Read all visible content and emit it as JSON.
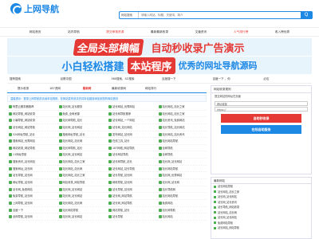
{
  "header": {
    "logo_text": "上网导航",
    "search_select": "网站搜索",
    "search_placeholder": "请输入网站、标题、关键词、简介",
    "search_button": "Q"
  },
  "nav": [
    "网站首页",
    "站内导航",
    "提交审核资源",
    "最新最新收录",
    "文章资讯",
    "人气排行榜",
    "收入榜优秀"
  ],
  "banner1": {
    "pill": "全局头部横幅",
    "text": "自动秒收录广告演示"
  },
  "banner2": {
    "t1": "小白轻松搭建",
    "pill": "本站程序",
    "t2": "优秀的网址导航源码"
  },
  "links": [
    "搜狗搜索",
    "谷歌中国",
    "360搜索、SO搜索",
    "百度搜一下",
    "百度一下 ，你",
    "必应"
  ],
  "tabs": [
    "提示收录",
    "187资网",
    "最新网",
    "最新收录网",
    "网站排行"
  ],
  "notice": "温馨提示：登录上网导航前请读本站规则，在网站发布前请先将本站链接添加到您的网站首页",
  "grid": [
    "阿里云服务器推荐",
    "站长网_站长服务",
    "站长网站_优秀网站",
    "站长网站_站长之家",
    "网站导航_网站收录",
    "免费_全网资源",
    "站长网导航推荐",
    "站长网站_站长之家",
    "小编导航_网站收录",
    "站长网导航_站长",
    "站长网站_一个网站",
    "站长资讯_免费网站",
    "站长网站_网站导航",
    "站长网_站长网站",
    "站长网_站长网站",
    "站长导航_站长网站",
    "520网址导航_站长",
    "搜索网址导航_站长",
    "发布网站_站长网",
    "站长网站_站长资讯",
    "搜索网站_优秀网站",
    "站长网站_站长网",
    "在线工具_站长",
    "站长网站导航",
    "网站收录_网站导航",
    "站长网导航_站长",
    "187网络_网站导航",
    "全网导航",
    "11网址导航",
    "站长网_站长网站",
    "站长网站导航",
    "全网导航",
    "搜索资讯_站长网站",
    "站长网站_站长之家",
    "站长网导航_站长",
    "站长网_站长网站",
    "搜索网址_站长网",
    "站长网站_站长网",
    "站长网站_站长导航",
    "站长网站导航",
    "站长导航_站长网",
    "站长网站_站长之家",
    "站长导航_站长网",
    "站长网_优秀网站",
    "网址导航_站长网",
    "网站收录_网站导航",
    "网络导航_站长网",
    "站长网_站长网",
    "站长网_免费网站",
    "站长网_站长网站",
    "站长导航_站长网",
    "站长导航网",
    "免费导航_站长网",
    "站长网_站长网站",
    "站长网_网站导航",
    "站长网站导航",
    "上网导航_站长网",
    "站长网站_站长网",
    "站长网_网站导航",
    "免费网站",
    "百度一下",
    "站长网站导航",
    "网站导航_站长",
    "站长网导航",
    "全网导航_站长网",
    "站长网_站长网站",
    "站长导航",
    "站长网站"
  ],
  "side": {
    "title": "网站收录规则",
    "text": "提交网站的网址在页面",
    "field1": "网址链接",
    "field2": "https://",
    "btn_red": "自助秒收录",
    "btn_blue": "在线自助服务"
  },
  "side2": {
    "title": "最新网站",
    "rows": [
      "站长网站导航",
      "站长网站_站长之家",
      "站长网_站长网站",
      "站长网_站长资讯",
      "站长导航_网站收录",
      "站长网站_站长网",
      "站长网_站长网站",
      "免费网站导航",
      "站长网站_网站导航"
    ]
  },
  "colors": {
    "accent": "#1e88e5",
    "hot": "#e53935",
    "icon": "#4caf50"
  }
}
